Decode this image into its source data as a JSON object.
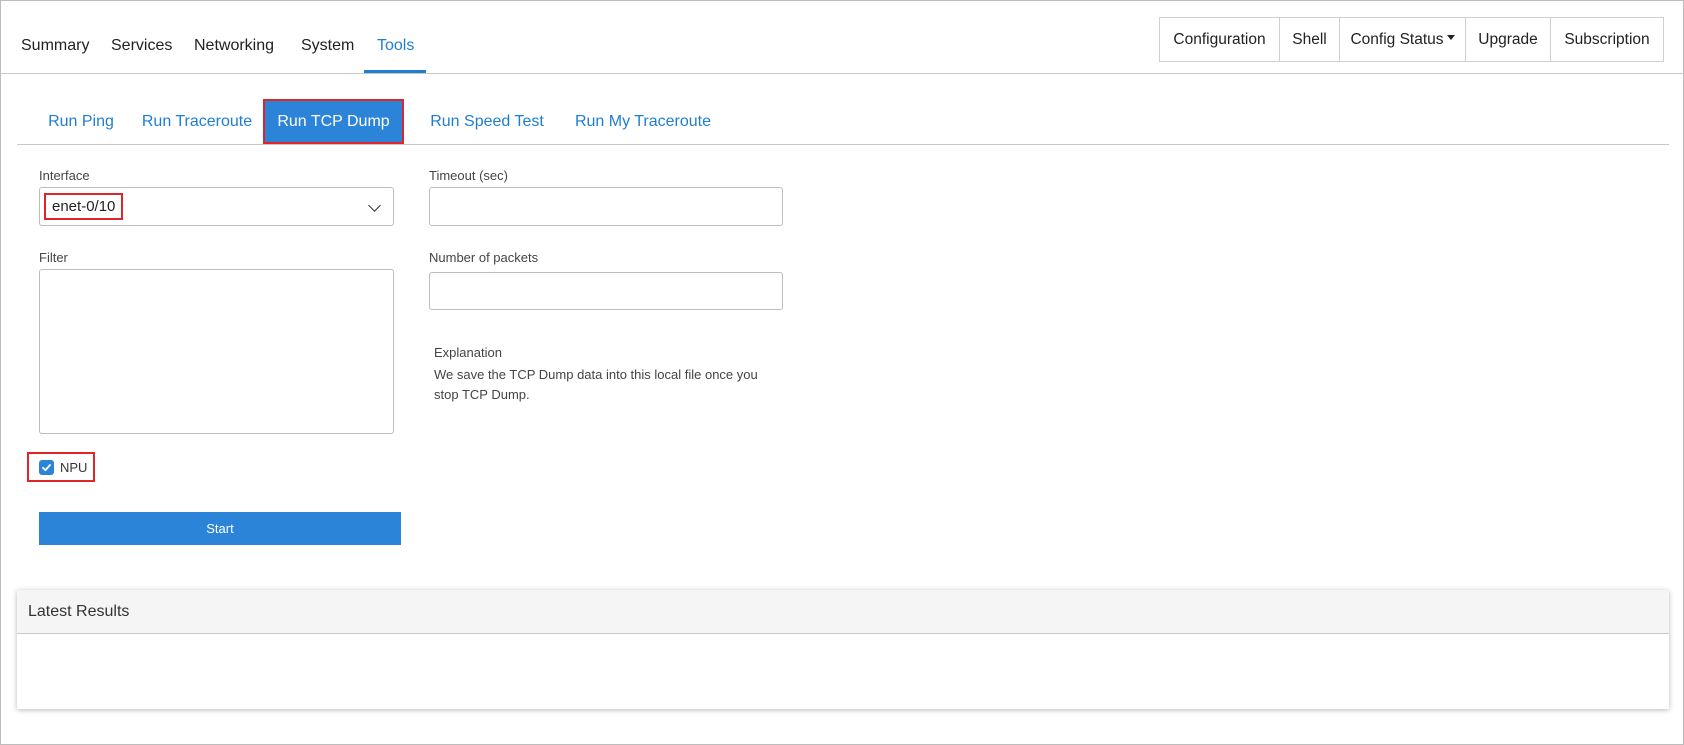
{
  "nav": {
    "tabs": [
      "Summary",
      "Services",
      "Networking",
      "System",
      "Tools"
    ],
    "active_tab": "Tools",
    "actions": [
      "Configuration",
      "Shell",
      "Config Status",
      "Upgrade",
      "Subscription"
    ]
  },
  "subtabs": {
    "items": [
      "Run Ping",
      "Run Traceroute",
      "Run TCP Dump",
      "Run Speed Test",
      "Run My Traceroute"
    ],
    "active": "Run TCP Dump"
  },
  "form": {
    "interface_label": "Interface",
    "interface_value": "enet-0/10",
    "timeout_label": "Timeout (sec)",
    "timeout_value": "",
    "filter_label": "Filter",
    "filter_value": "",
    "packets_label": "Number of packets",
    "packets_value": "",
    "npu_label": "NPU",
    "npu_checked": true,
    "start_label": "Start",
    "explanation_title": "Explanation",
    "explanation_text": "We save the TCP Dump data into this local file once you stop TCP Dump."
  },
  "results": {
    "title": "Latest Results"
  },
  "colors": {
    "accent": "#2b84d8",
    "link": "#1f7ed0",
    "highlight": "#e0242a"
  }
}
